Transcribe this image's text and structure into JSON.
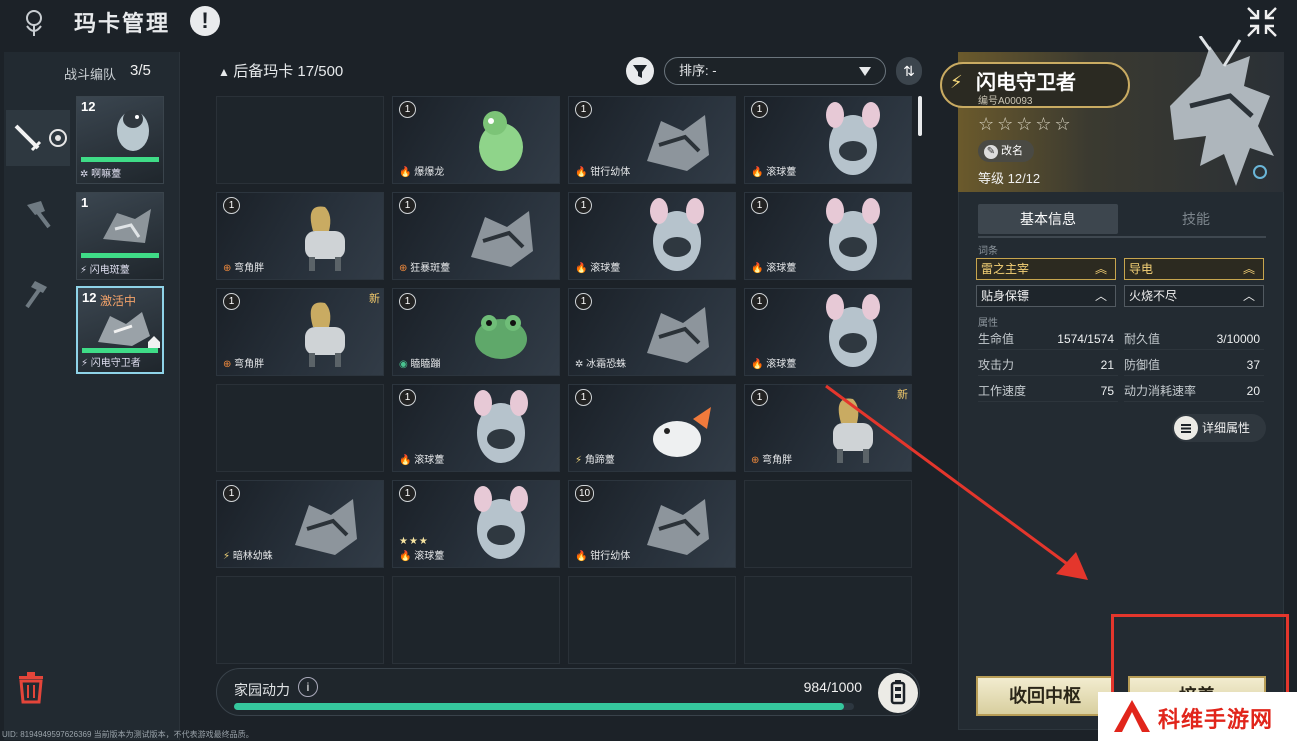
{
  "header": {
    "title": "玛卡管理",
    "alert_icon": "exclamation-icon",
    "close_icon": "collapse-icon"
  },
  "team": {
    "label": "战斗编队",
    "count": "3/5",
    "slots": [
      {
        "level": "12",
        "name": "✲ 啊嘛薹",
        "hp": 1.0
      },
      {
        "level": "1",
        "name": "⚡ 闪电斑薹",
        "hp": 1.0
      },
      {
        "level": "12",
        "name": "⚡ 闪电守卫者",
        "hp": 1.0,
        "badge": "激活中"
      }
    ]
  },
  "reserve": {
    "header": "后备玛卡 17/500",
    "sort_label": "排序: -",
    "cards": [
      {
        "empty": true
      },
      {
        "level": "1",
        "name": "爆爆龙",
        "element": "fire"
      },
      {
        "level": "1",
        "name": "钳行幼体",
        "element": "fire"
      },
      {
        "level": "1",
        "name": "滚球薹",
        "element": "fire"
      },
      {
        "level": "1",
        "name": "弯角胖",
        "element": "cross"
      },
      {
        "level": "1",
        "name": "狂暴斑薹",
        "element": "cross"
      },
      {
        "level": "1",
        "name": "滚球薹",
        "element": "fire"
      },
      {
        "level": "1",
        "name": "滚球薹",
        "element": "fire"
      },
      {
        "level": "1",
        "name": "弯角胖",
        "element": "cross",
        "new": "新"
      },
      {
        "level": "1",
        "name": "瞌瞌蹦",
        "element": "eye"
      },
      {
        "level": "1",
        "name": "冰霜恐蛛",
        "element": "snow"
      },
      {
        "level": "1",
        "name": "滚球薹",
        "element": "fire"
      },
      {
        "empty": true
      },
      {
        "level": "1",
        "name": "滚球薹",
        "element": "fire"
      },
      {
        "level": "1",
        "name": "角蹄薹",
        "element": "bolt"
      },
      {
        "level": "1",
        "name": "弯角胖",
        "element": "cross",
        "new": "新"
      },
      {
        "level": "1",
        "name": "暗林幼蛛",
        "element": "bolt"
      },
      {
        "level": "1",
        "name": "滚球薹",
        "element": "fire",
        "stars": "★★★"
      },
      {
        "level": "10",
        "name": "钳行幼体",
        "element": "fire"
      },
      {
        "empty": true
      },
      {
        "empty": true
      },
      {
        "empty": true
      },
      {
        "empty": true
      },
      {
        "empty": true
      }
    ]
  },
  "power": {
    "label": "家园动力",
    "value": "984/1000",
    "fraction": 0.984
  },
  "detail": {
    "name": "闪电守卫者",
    "id": "编号A00093",
    "stars": "☆☆☆☆☆",
    "rename_label": "改名",
    "level": "等级 12/12",
    "tab_basic": "基本信息",
    "tab_skill": "技能",
    "entries_label": "词条",
    "entries": [
      {
        "name": "雷之主宰",
        "chev": "︽",
        "gold": true
      },
      {
        "name": "导电",
        "chev": "︽",
        "gold": true
      },
      {
        "name": "贴身保镖",
        "chev": "︿",
        "gold": false
      },
      {
        "name": "火烧不尽",
        "chev": "︿",
        "gold": false
      }
    ],
    "attr_label": "属性",
    "stats": [
      {
        "name": "生命值",
        "value": "1574/1574"
      },
      {
        "name": "耐久值",
        "value": "3/10000"
      },
      {
        "name": "攻击力",
        "value": "21"
      },
      {
        "name": "防御值",
        "value": "37"
      },
      {
        "name": "工作速度",
        "value": "75"
      },
      {
        "name": "动力消耗速率",
        "value": "20"
      }
    ],
    "detail_attr_btn": "详细属性",
    "recall_btn": "收回中枢",
    "equip_btn": "培养"
  },
  "footer": {
    "uid": "UID: 8194949597626369 当前版本为测试版本，不代表游戏最终品质。"
  },
  "watermark": "科维手游网",
  "colors": {
    "accent_gold": "#c9ab62",
    "power_fill": "#35c79d",
    "annotation_red": "#e4362c",
    "hp_green": "#3fdc87"
  }
}
